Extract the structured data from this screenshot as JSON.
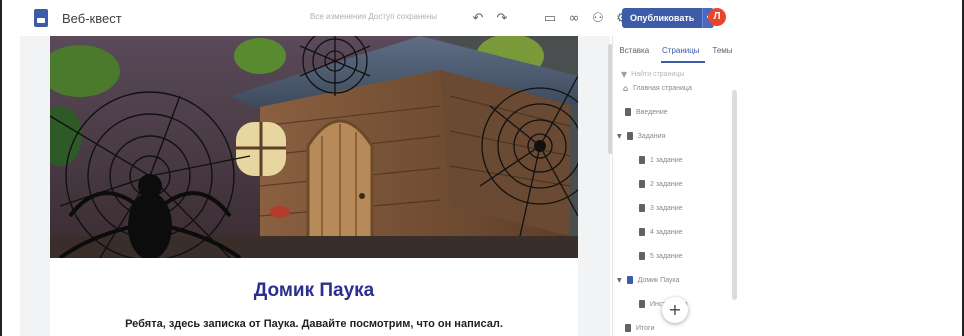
{
  "header": {
    "title": "Веб-квест",
    "draft_status": "Все изменения Доступ сохранены",
    "publish_label": "Опубликовать",
    "avatar_letter": "Л"
  },
  "toolbar": {
    "icons": [
      "undo-icon",
      "redo-icon",
      "preview-icon",
      "link-icon",
      "share-icon",
      "settings-icon",
      "more-icon"
    ]
  },
  "page": {
    "heading": "Домик Паука",
    "text": "Ребята, здесь записка от Паука. Давайте посмотрим, что он написал."
  },
  "panel": {
    "tabs": [
      "Вставка",
      "Страницы",
      "Темы"
    ],
    "active_tab": "Страницы",
    "search_placeholder": "Найти страницы",
    "pages": [
      {
        "label": "Главная страница",
        "level": 0,
        "home": true
      },
      {
        "label": "Введение",
        "level": 0
      },
      {
        "label": "Задания",
        "level": 0,
        "expanded": true
      },
      {
        "label": "1 задание",
        "level": 1
      },
      {
        "label": "2 задание",
        "level": 1
      },
      {
        "label": "3 задание",
        "level": 1
      },
      {
        "label": "4 задание",
        "level": 1
      },
      {
        "label": "5 задание",
        "level": 1
      },
      {
        "label": "Домик Паука",
        "level": 0,
        "expanded": true,
        "current": true
      },
      {
        "label": "Инструкция",
        "level": 1
      },
      {
        "label": "Итоги",
        "level": 0
      }
    ]
  },
  "colors": {
    "accent": "#3c5ba8",
    "heading": "#2b2f8f",
    "avatar": "#e8462b"
  }
}
